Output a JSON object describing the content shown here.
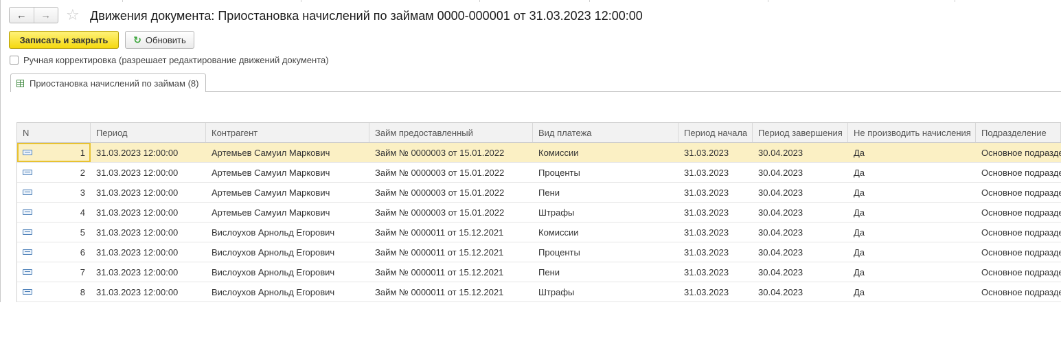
{
  "window": {
    "title": "Движения документа: Приостановка начислений по займам 0000-000001 от 31.03.2023 12:00:00"
  },
  "nav": {
    "back_icon": "arrow-left-icon",
    "forward_icon": "arrow-right-icon",
    "favorite_icon": "star-icon"
  },
  "toolbar": {
    "save_close_label": "Записать и закрыть",
    "refresh_label": "Обновить"
  },
  "manual_edit": {
    "label": "Ручная корректировка (разрешает редактирование движений документа)",
    "checked": false
  },
  "tabs": [
    {
      "label": "Приостановка начислений по займам (8)"
    }
  ],
  "table": {
    "columns": [
      "N",
      "Период",
      "Контрагент",
      "Займ предоставленный",
      "Вид платежа",
      "Период начала",
      "Период завершения",
      "Не производить начисления",
      "Подразделение"
    ],
    "rows": [
      {
        "n": "1",
        "period": "31.03.2023 12:00:00",
        "counterparty": "Артемьев Самуил Маркович",
        "loan": "Займ № 0000003 от 15.01.2022",
        "payment_type": "Комиссии",
        "start": "31.03.2023",
        "end": "30.04.2023",
        "no_accrual": "Да",
        "division": "Основное подразде"
      },
      {
        "n": "2",
        "period": "31.03.2023 12:00:00",
        "counterparty": "Артемьев Самуил Маркович",
        "loan": "Займ № 0000003 от 15.01.2022",
        "payment_type": "Проценты",
        "start": "31.03.2023",
        "end": "30.04.2023",
        "no_accrual": "Да",
        "division": "Основное подразде"
      },
      {
        "n": "3",
        "period": "31.03.2023 12:00:00",
        "counterparty": "Артемьев Самуил Маркович",
        "loan": "Займ № 0000003 от 15.01.2022",
        "payment_type": "Пени",
        "start": "31.03.2023",
        "end": "30.04.2023",
        "no_accrual": "Да",
        "division": "Основное подразде"
      },
      {
        "n": "4",
        "period": "31.03.2023 12:00:00",
        "counterparty": "Артемьев Самуил Маркович",
        "loan": "Займ № 0000003 от 15.01.2022",
        "payment_type": "Штрафы",
        "start": "31.03.2023",
        "end": "30.04.2023",
        "no_accrual": "Да",
        "division": "Основное подразде"
      },
      {
        "n": "5",
        "period": "31.03.2023 12:00:00",
        "counterparty": "Вислоухов Арнольд Егорович",
        "loan": "Займ № 0000011 от 15.12.2021",
        "payment_type": "Комиссии",
        "start": "31.03.2023",
        "end": "30.04.2023",
        "no_accrual": "Да",
        "division": "Основное подразде"
      },
      {
        "n": "6",
        "period": "31.03.2023 12:00:00",
        "counterparty": "Вислоухов Арнольд Егорович",
        "loan": "Займ № 0000011 от 15.12.2021",
        "payment_type": "Проценты",
        "start": "31.03.2023",
        "end": "30.04.2023",
        "no_accrual": "Да",
        "division": "Основное подразде"
      },
      {
        "n": "7",
        "period": "31.03.2023 12:00:00",
        "counterparty": "Вислоухов Арнольд Егорович",
        "loan": "Займ № 0000011 от 15.12.2021",
        "payment_type": "Пени",
        "start": "31.03.2023",
        "end": "30.04.2023",
        "no_accrual": "Да",
        "division": "Основное подразде"
      },
      {
        "n": "8",
        "period": "31.03.2023 12:00:00",
        "counterparty": "Вислоухов Арнольд Егорович",
        "loan": "Займ № 0000011 от 15.12.2021",
        "payment_type": "Штрафы",
        "start": "31.03.2023",
        "end": "30.04.2023",
        "no_accrual": "Да",
        "division": "Основное подразде"
      }
    ],
    "selected_row": 1,
    "row_icon": "register-record-icon"
  },
  "colors": {
    "primary_button": "#f5d80f",
    "selected_row": "#fbf0c4",
    "selected_outline": "#e8c230",
    "refresh_icon": "#3aa53a"
  }
}
